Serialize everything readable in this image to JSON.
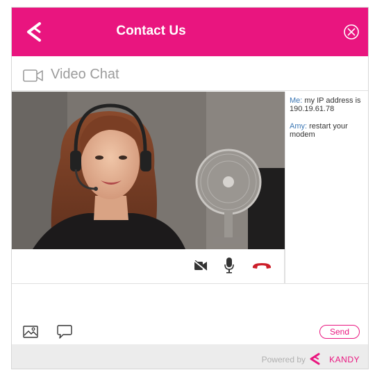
{
  "header": {
    "title": "Contact Us",
    "logo_icon": "kandy-logo-icon",
    "close_icon": "close-circle-icon"
  },
  "section": {
    "title": "Video Chat",
    "icon": "video-camera-icon"
  },
  "controls": [
    {
      "name": "camera-off",
      "icon": "video-off-icon"
    },
    {
      "name": "microphone",
      "icon": "microphone-icon"
    },
    {
      "name": "hang-up",
      "icon": "phone-hangup-icon",
      "color": "#cc1f2a"
    }
  ],
  "transcript": [
    {
      "sender": "Me:",
      "text": "my IP address is 190.19.61.78"
    },
    {
      "sender": "Amy:",
      "text": "restart your modem"
    }
  ],
  "compose": {
    "image_icon": "image-icon",
    "chat_icon": "speech-bubble-icon",
    "send_label": "Send"
  },
  "footer": {
    "powered_by": "Powered by",
    "brand": "KANDY"
  },
  "colors": {
    "accent": "#e9157f",
    "sender": "#3a76b4",
    "hangup": "#cc1f2a"
  }
}
